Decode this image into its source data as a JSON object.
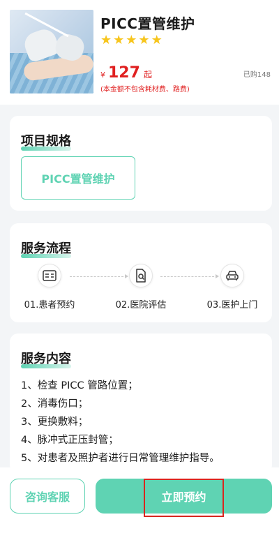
{
  "product": {
    "title": "PICC置管维护",
    "rating_stars": 5,
    "star_glyph": "★",
    "price_currency": "¥",
    "price_value": "127",
    "price_unit": "起",
    "sold": "已购148",
    "price_note": "(本金额不包含耗材费、路费)"
  },
  "spec": {
    "title": "项目规格",
    "option": "PICC置管维护"
  },
  "flow": {
    "title": "服务流程",
    "steps": [
      {
        "label": "01.患者预约",
        "icon": "id-card-icon"
      },
      {
        "label": "02.医院评估",
        "icon": "document-search-icon"
      },
      {
        "label": "03.医护上门",
        "icon": "car-icon"
      }
    ]
  },
  "content": {
    "title": "服务内容",
    "items": [
      "1、检查 PICC 管路位置；",
      "2、消毒伤口；",
      "3、更换敷料；",
      "4、脉冲式正压封管；",
      "5、对患者及照护者进行日常管理维护指导。"
    ]
  },
  "actions": {
    "consult": "咨询客服",
    "book": "立即预约"
  },
  "colors": {
    "accent": "#5fd3b3",
    "price": "#e02020",
    "star": "#f7c51c",
    "highlight": "#d8261f"
  }
}
